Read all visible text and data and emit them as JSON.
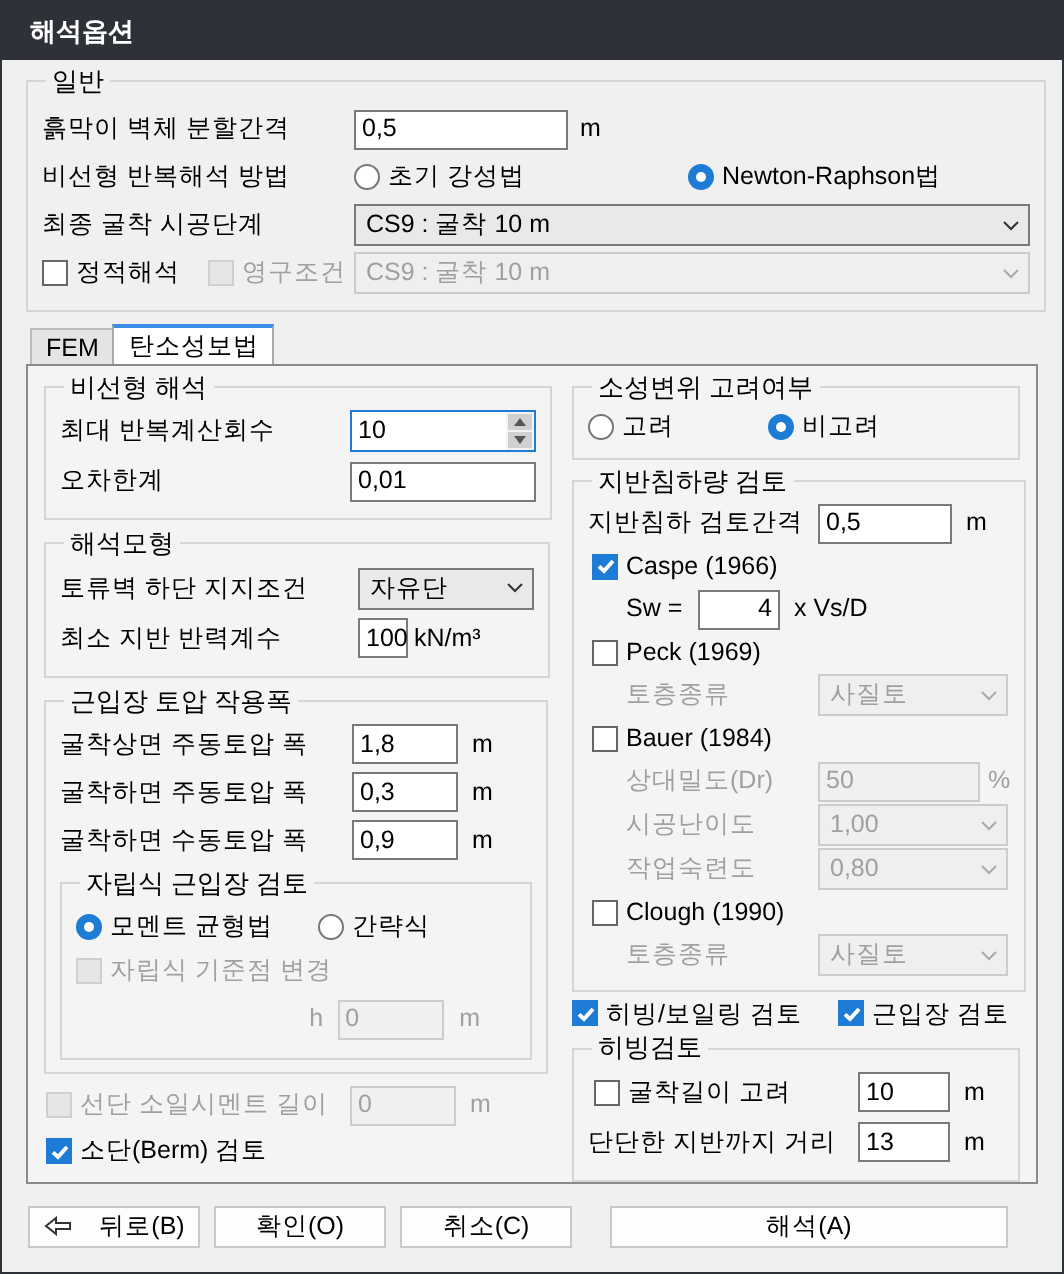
{
  "window": {
    "title": "해석옵션"
  },
  "general": {
    "legend": "일반",
    "wall_division": {
      "label": "흙막이 벽체 분할간격",
      "value": "0,5",
      "unit": "m"
    },
    "nonlinear_method": {
      "label": "비선형 반복해석 방법",
      "options": [
        {
          "label": "초기 강성법",
          "selected": false
        },
        {
          "label": "Newton-Raphson법",
          "selected": true
        }
      ]
    },
    "final_stage": {
      "label": "최종 굴착 시공단계",
      "value": "CS9 : 굴착 10 m"
    },
    "static": {
      "label": "정적해석",
      "checked": false
    },
    "permanent": {
      "label": "영구조건",
      "checked": false,
      "disabled": true
    },
    "permanent_stage": {
      "value": "CS9 : 굴착 10 m",
      "disabled": true
    }
  },
  "tabs": [
    {
      "label": "FEM",
      "selected": false
    },
    {
      "label": "탄소성보법",
      "selected": true
    }
  ],
  "nonlinear": {
    "legend": "비선형 해석",
    "max_iter": {
      "label": "최대 반복계산회수",
      "value": "10"
    },
    "tolerance": {
      "label": "오차한계",
      "value": "0,01"
    }
  },
  "model": {
    "legend": "해석모형",
    "support": {
      "label": "토류벽 하단 지지조건",
      "value": "자유단"
    },
    "subgrade": {
      "label": "최소 지반 반력계수",
      "value": "100",
      "unit": "kN/m³"
    }
  },
  "earth_pressure": {
    "legend": "근입장 토압 작용폭",
    "rows": [
      {
        "label": "굴착상면 주동토압 폭",
        "value": "1,8",
        "unit": "m"
      },
      {
        "label": "굴착하면 주동토압 폭",
        "value": "0,3",
        "unit": "m"
      },
      {
        "label": "굴착하면 수동토압 폭",
        "value": "0,9",
        "unit": "m"
      }
    ],
    "self_standing": {
      "legend": "자립식 근입장 검토",
      "options": [
        {
          "label": "모멘트 균형법",
          "selected": true
        },
        {
          "label": "간략식",
          "selected": false
        }
      ],
      "change_ref": {
        "label": "자립식 기준점 변경",
        "checked": false,
        "disabled": true
      },
      "h": {
        "label": "h",
        "value": "0",
        "unit": "m",
        "disabled": true
      }
    }
  },
  "soil_cement": {
    "label": "선단 소일시멘트 길이",
    "checked": false,
    "disabled": true,
    "value": "0",
    "unit": "m"
  },
  "berm": {
    "label": "소단(Berm) 검토",
    "checked": true
  },
  "plastic": {
    "legend": "소성변위 고려여부",
    "options": [
      {
        "label": "고려",
        "selected": false
      },
      {
        "label": "비고려",
        "selected": true
      }
    ]
  },
  "settlement": {
    "legend": "지반침하량 검토",
    "interval": {
      "label": "지반침하 검토간격",
      "value": "0,5",
      "unit": "m"
    },
    "methods": [
      {
        "label": "Caspe (1966)",
        "checked": true,
        "params": [
          {
            "kind": "sw",
            "label": "Sw =",
            "value": "4",
            "unit": "x Vs/D"
          }
        ]
      },
      {
        "label": "Peck (1969)",
        "checked": false,
        "params": [
          {
            "kind": "combo",
            "label": "토층종류",
            "value": "사질토"
          }
        ]
      },
      {
        "label": "Bauer (1984)",
        "checked": false,
        "params": [
          {
            "kind": "field",
            "label": "상대밀도(Dr)",
            "value": "50",
            "unit": "%"
          },
          {
            "kind": "combo",
            "label": "시공난이도",
            "value": "1,00"
          },
          {
            "kind": "combo",
            "label": "작업숙련도",
            "value": "0,80"
          }
        ]
      },
      {
        "label": "Clough (1990)",
        "checked": false,
        "params": [
          {
            "kind": "combo",
            "label": "토층종류",
            "value": "사질토"
          }
        ]
      }
    ]
  },
  "heaving_check": {
    "label": "히빙/보일링 검토",
    "checked": true
  },
  "embed_check": {
    "label": "근입장 검토",
    "checked": true
  },
  "heaving": {
    "legend": "히빙검토",
    "depth": {
      "label": "굴착길이 고려",
      "checked": false,
      "value": "10",
      "unit": "m"
    },
    "distance": {
      "label": "단단한 지반까지 거리",
      "value": "13",
      "unit": "m"
    }
  },
  "buttons": [
    {
      "kind": "back",
      "label": "뒤로(B)"
    },
    {
      "kind": "plain",
      "label": "확인(O)"
    },
    {
      "kind": "plain",
      "label": "취소(C)"
    },
    {
      "kind": "wide",
      "label": "해석(A)"
    }
  ]
}
